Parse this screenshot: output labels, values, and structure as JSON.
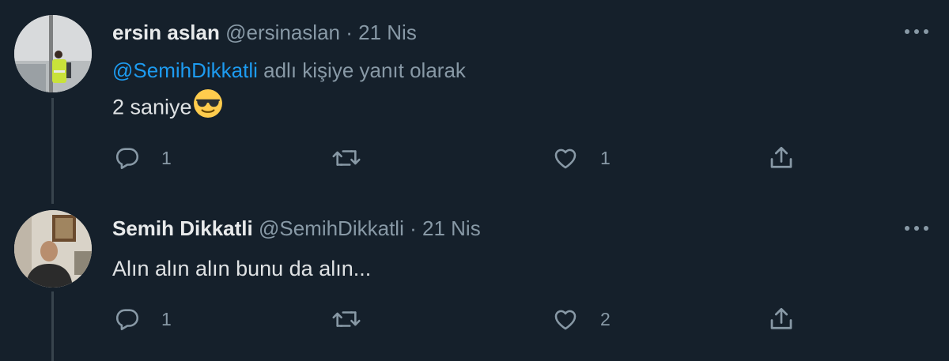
{
  "tweets": [
    {
      "display_name": "ersin aslan",
      "handle": "@ersinaslan",
      "separator": "·",
      "date": "21 Nis",
      "reply_to_mention": "@SemihDikkatli",
      "reply_to_suffix": "adlı kişiye yanıt olarak",
      "text": "2 saniye",
      "emoji": "smiling-face-with-sunglasses",
      "reply_count": "1",
      "retweet_count": "",
      "like_count": "1"
    },
    {
      "display_name": "Semih Dikkatli",
      "handle": "@SemihDikkatli",
      "separator": "·",
      "date": "21 Nis",
      "text": "Alın alın alın bunu da alın...",
      "reply_count": "1",
      "retweet_count": "",
      "like_count": "2"
    }
  ],
  "colors": {
    "background": "#15202b",
    "muted": "#8899a6",
    "link": "#1d9bf0",
    "thread_line": "#38444d"
  },
  "icons": [
    "more-icon",
    "reply-icon",
    "retweet-icon",
    "like-icon",
    "share-icon"
  ]
}
